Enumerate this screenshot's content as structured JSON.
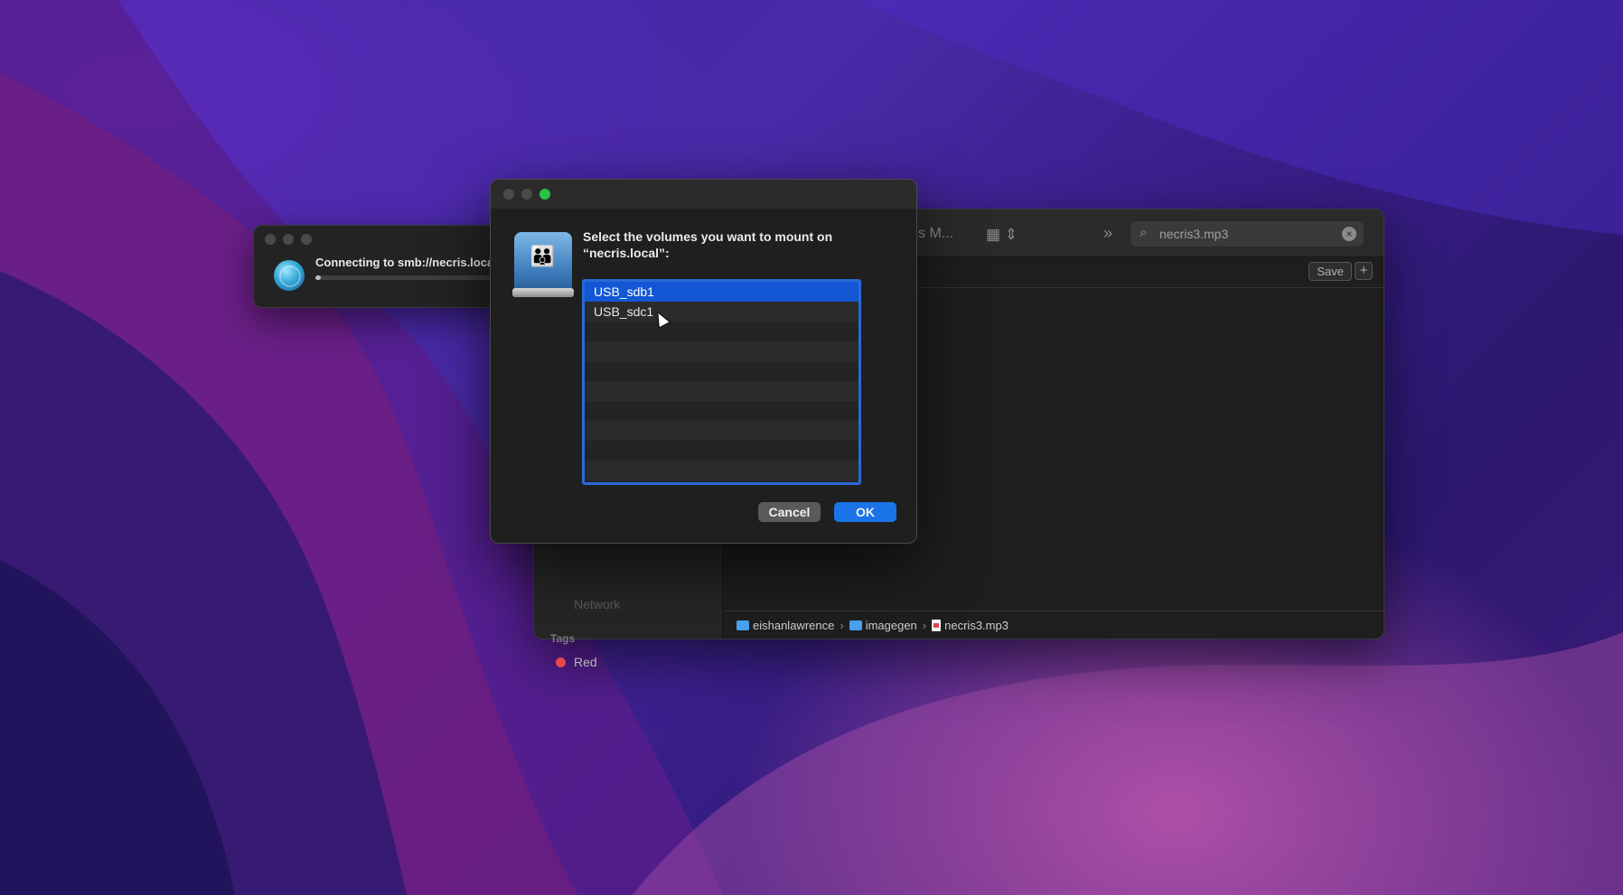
{
  "finder": {
    "title_fragment": "s M...",
    "search_text": "necris3.mp3",
    "save_label": "Save",
    "plus_label": "+",
    "sidebar": {
      "network_label": "Network",
      "tags_heading": "Tags",
      "tag_red": "Red"
    },
    "path": [
      "eishanlawrence",
      "imagegen",
      "necris3.mp3"
    ],
    "path_separator": "›"
  },
  "connect_window": {
    "status_text": "Connecting to smb://necris.local/",
    "progress": 0.03
  },
  "mount_dialog": {
    "prompt": "Select the volumes you want to mount on “necris.local”:",
    "volumes": [
      {
        "label": "USB_sdb1",
        "selected": true
      },
      {
        "label": "USB_sdc1",
        "selected": false
      }
    ],
    "cancel_label": "Cancel",
    "ok_label": "OK"
  },
  "icons": {
    "globe": "network-globe-icon",
    "drive": "shared-drive-icon",
    "search": "search-icon",
    "clear": "clear-icon",
    "grid": "grid-view-icon",
    "more": "chevron-more-icon"
  },
  "colors": {
    "accent": "#1a74e8",
    "selection": "#1357d4",
    "tag_red": "#e5484d",
    "traffic_green": "#2ac144"
  }
}
